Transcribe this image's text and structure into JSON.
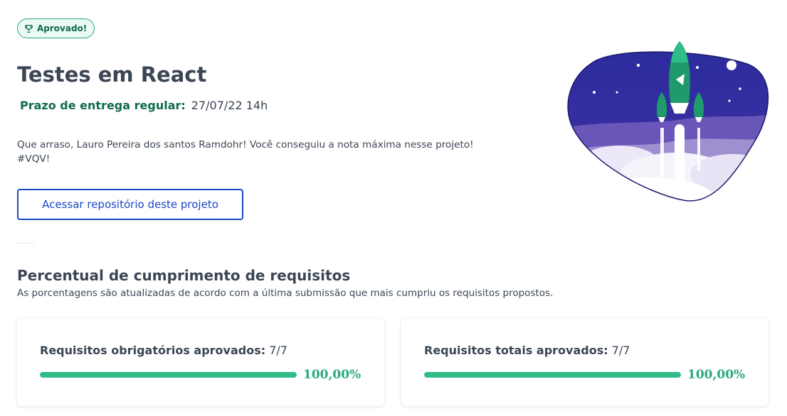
{
  "badge": {
    "label": "Aprovado!",
    "icon": "trophy-icon"
  },
  "project": {
    "title": "Testes em React",
    "deadline_label": "Prazo de entrega regular:",
    "deadline_value": "27/07/22 14h",
    "message_line1": "Que arraso, Lauro Pereira dos santos Ramdohr! Você conseguiu a nota máxima nesse projeto!",
    "message_line2": "#VQV!",
    "repo_button": "Acessar repositório deste projeto"
  },
  "requirements": {
    "title": "Percentual de cumprimento de requisitos",
    "subtitle": "As porcentagens são atualizadas de acordo com a última submissão que mais cumpriu os requisitos propostos.",
    "cards": [
      {
        "label": "Requisitos obrigatórios aprovados:",
        "count": "7/7",
        "percent_text": "100,00%",
        "progress": 1.0
      },
      {
        "label": "Requisitos totais aprovados:",
        "count": "7/7",
        "percent_text": "100,00%",
        "progress": 1.0
      }
    ]
  },
  "colors": {
    "accent_green": "#2fbc87",
    "dark_green": "#0f6b4b",
    "link_blue": "#1a47c8",
    "text": "#3b4554",
    "illustration_bg": "#2b2a9a"
  }
}
